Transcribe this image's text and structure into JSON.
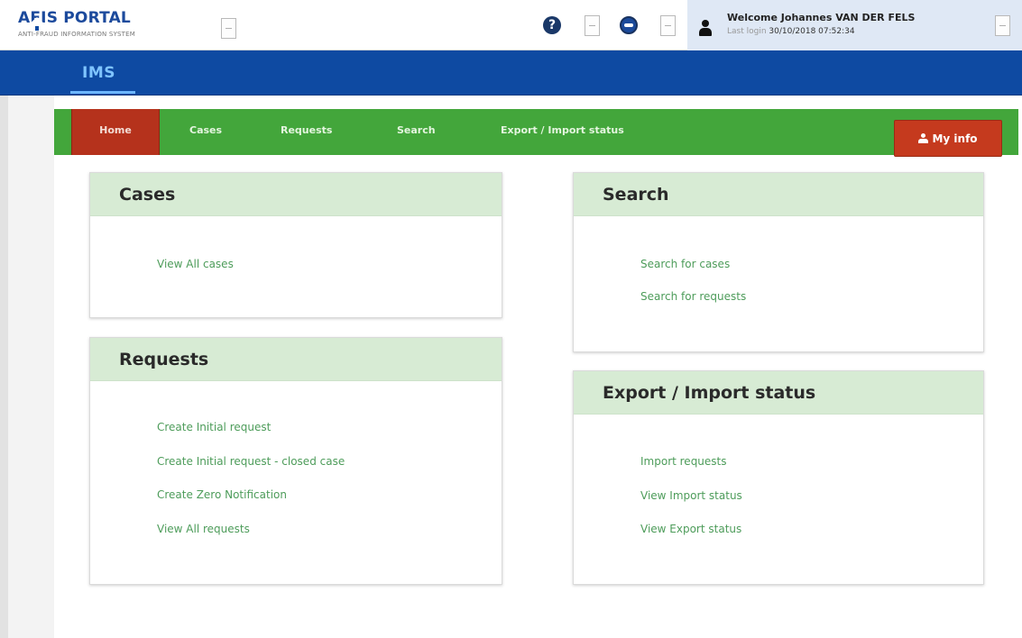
{
  "header": {
    "portal_title": "AFIS PORTAL",
    "portal_subtitle": "ANTI-FRAUD INFORMATION SYSTEM",
    "help_icon": "question-circle-icon",
    "eu_icon": "eu-flag-icon",
    "user_icon": "user-icon",
    "welcome": "Welcome Johannes VAN DER FELS",
    "last_login_label": "Last login",
    "last_login_value": "30/10/2018 07:52:34"
  },
  "appbar": {
    "home_icon": "home-icon",
    "active_app": "IMS"
  },
  "nav": {
    "items": [
      {
        "label": "Home",
        "active": true
      },
      {
        "label": "Cases",
        "active": false
      },
      {
        "label": "Requests",
        "active": false
      },
      {
        "label": "Search",
        "active": false
      },
      {
        "label": "Export / Import status",
        "active": false
      }
    ],
    "my_info": "My info"
  },
  "panels": {
    "cases": {
      "title": "Cases",
      "links": [
        "View All cases"
      ]
    },
    "requests": {
      "title": "Requests",
      "links": [
        "Create Initial request",
        "Create Initial request - closed case",
        "Create Zero Notification",
        "View All requests"
      ]
    },
    "search": {
      "title": "Search",
      "links": [
        "Search for cases",
        "Search for requests"
      ]
    },
    "export_import": {
      "title": "Export / Import status",
      "links": [
        "Import requests",
        "View Import status",
        "View Export status"
      ]
    }
  },
  "colors": {
    "brand_blue": "#0e4aa2",
    "nav_green": "#43a63b",
    "active_red": "#b5321c",
    "panel_head": "#d7ebd4",
    "link_green": "#4d9c5a"
  }
}
